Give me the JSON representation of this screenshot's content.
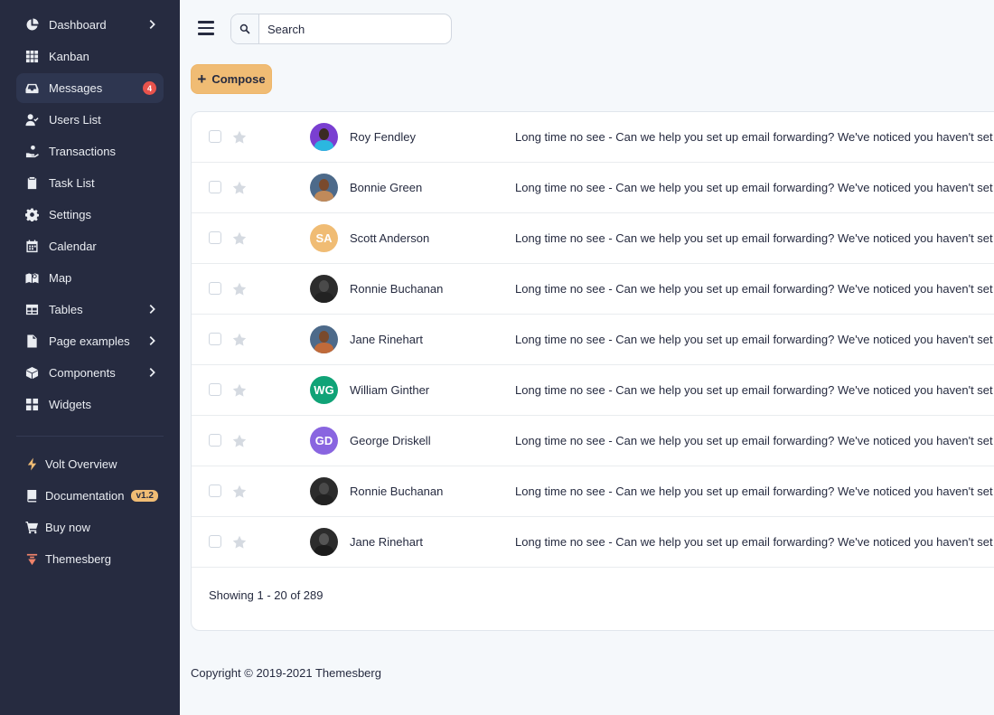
{
  "sidebar": {
    "items": [
      {
        "label": "Dashboard",
        "icon": "pie-chart-icon",
        "chevron": true
      },
      {
        "label": "Kanban",
        "icon": "grid-icon",
        "chevron": false
      },
      {
        "label": "Messages",
        "icon": "inbox-icon",
        "chevron": false,
        "active": true,
        "badge": "4"
      },
      {
        "label": "Users List",
        "icon": "user-check-icon",
        "chevron": false
      },
      {
        "label": "Transactions",
        "icon": "hand-coin-icon",
        "chevron": false
      },
      {
        "label": "Task List",
        "icon": "clipboard-icon",
        "chevron": false
      },
      {
        "label": "Settings",
        "icon": "gear-icon",
        "chevron": false
      },
      {
        "label": "Calendar",
        "icon": "calendar-icon",
        "chevron": false
      },
      {
        "label": "Map",
        "icon": "map-icon",
        "chevron": false
      },
      {
        "label": "Tables",
        "icon": "table-icon",
        "chevron": true
      },
      {
        "label": "Page examples",
        "icon": "file-icon",
        "chevron": true
      },
      {
        "label": "Components",
        "icon": "box-icon",
        "chevron": true
      },
      {
        "label": "Widgets",
        "icon": "widgets-icon",
        "chevron": false
      }
    ],
    "secondary": [
      {
        "label": "Volt Overview",
        "icon": "lightning-icon"
      },
      {
        "label": "Documentation",
        "icon": "book-icon",
        "badge": "v1.2"
      },
      {
        "label": "Buy now",
        "icon": "cart-icon"
      },
      {
        "label": "Themesberg",
        "icon": "themesberg-logo-icon"
      }
    ]
  },
  "search": {
    "placeholder": "Search"
  },
  "compose": {
    "label": "Compose"
  },
  "messages": [
    {
      "name": "Roy Fendley",
      "subject": "Long time no see - Can we help you set up email forwarding? We've noticed you haven't set up email forwarding",
      "avatar_type": "photo",
      "colors": [
        "#7a3fd1",
        "#3b2a24",
        "#2bb7e0"
      ]
    },
    {
      "name": "Bonnie Green",
      "subject": "Long time no see - Can we help you set up email forwarding? We've noticed you haven't set up email forwarding",
      "avatar_type": "photo",
      "colors": [
        "#4d6a8a",
        "#7a4a2c",
        "#c08a5a"
      ]
    },
    {
      "name": "Scott Anderson",
      "subject": "Long time no see - Can we help you set up email forwarding? We've noticed you haven't set up email forwarding",
      "avatar_type": "initials",
      "initials": "SA",
      "color": "#f0bc74"
    },
    {
      "name": "Ronnie Buchanan",
      "subject": "Long time no see - Can we help you set up email forwarding? We've noticed you haven't set up email forwarding",
      "avatar_type": "photo",
      "colors": [
        "#2c2c2c",
        "#4a4a4a",
        "#222222"
      ]
    },
    {
      "name": "Jane Rinehart",
      "subject": "Long time no see - Can we help you set up email forwarding? We've noticed you haven't set up email forwarding",
      "avatar_type": "photo",
      "colors": [
        "#4d6a8a",
        "#7a4a2c",
        "#c06a3a"
      ]
    },
    {
      "name": "William Ginther",
      "subject": "Long time no see - Can we help you set up email forwarding? We've noticed you haven't set up email forwarding",
      "avatar_type": "initials",
      "initials": "WG",
      "color": "#10a377"
    },
    {
      "name": "George Driskell",
      "subject": "Long time no see - Can we help you set up email forwarding? We've noticed you haven't set up email forwarding",
      "avatar_type": "initials",
      "initials": "GD",
      "color": "#8965e0"
    },
    {
      "name": "Ronnie Buchanan",
      "subject": "Long time no see - Can we help you set up email forwarding? We've noticed you haven't set up email forwarding",
      "avatar_type": "photo",
      "colors": [
        "#2c2c2c",
        "#4a4a4a",
        "#222222"
      ]
    },
    {
      "name": "Jane Rinehart",
      "subject": "Long time no see - Can we help you set up email forwarding? We've noticed you haven't set up email forwarding",
      "avatar_type": "photo",
      "colors": [
        "#2c2c2c",
        "#555555",
        "#1c1c1c"
      ]
    }
  ],
  "pagination": {
    "showing": "Showing 1 - 20 of 289"
  },
  "footer": {
    "copyright": "Copyright © 2019-2021 Themesberg"
  }
}
